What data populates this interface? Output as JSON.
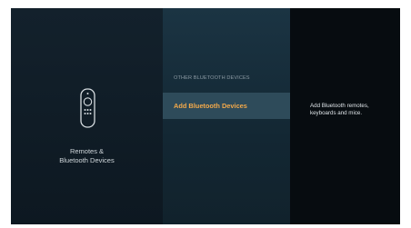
{
  "category": {
    "title_line1": "Remotes &",
    "title_line2": "Bluetooth Devices",
    "icon": "remote-control-icon"
  },
  "section": {
    "header": "OTHER BLUETOOTH DEVICES",
    "items": [
      {
        "label": "Add Bluetooth Devices",
        "selected": true
      }
    ]
  },
  "detail": {
    "description": "Add Bluetooth remotes, keyboards and mice."
  },
  "colors": {
    "accent": "#f3a94a",
    "selected_row": "#2e4b5a",
    "background": "#0e1a23"
  }
}
